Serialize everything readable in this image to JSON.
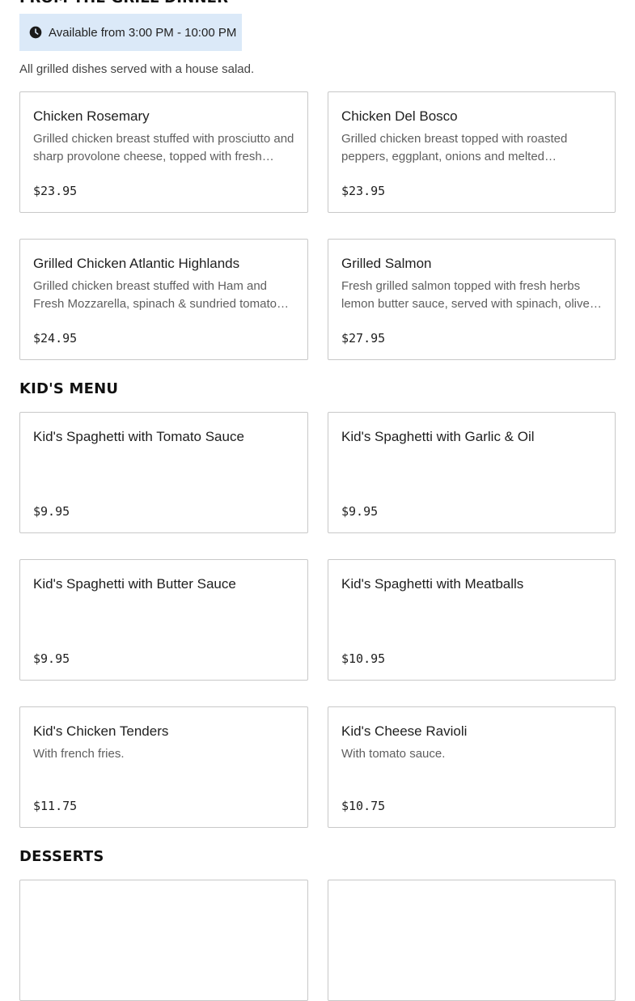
{
  "grill": {
    "title": "FROM THE GRILL DINNER",
    "availability": "Available from 3:00 PM - 10:00 PM",
    "note": "All grilled dishes served with a house salad.",
    "items": [
      {
        "name": "Chicken Rosemary",
        "description": "Grilled chicken breast stuffed with prosciutto and sharp provolone cheese, topped with fresh rosemary",
        "price": "$23.95"
      },
      {
        "name": "Chicken Del Bosco",
        "description": "Grilled chicken breast topped with roasted peppers, eggplant, onions and melted mozzarella cheese",
        "price": "$23.95"
      },
      {
        "name": "Grilled Chicken Atlantic Highlands",
        "description": "Grilled chicken breast stuffed with Ham and Fresh Mozzarella, spinach & sundried tomatoes, & a sauce",
        "price": "$24.95"
      },
      {
        "name": "Grilled Salmon",
        "description": "Fresh grilled salmon topped with fresh herbs lemon butter sauce, served with spinach, olive oil and garlic",
        "price": "$27.95"
      }
    ]
  },
  "kids": {
    "title": "KID'S MENU",
    "items": [
      {
        "name": "Kid's Spaghetti with Tomato Sauce",
        "description": "",
        "price": "$9.95"
      },
      {
        "name": "Kid's Spaghetti with Garlic & Oil",
        "description": "",
        "price": "$9.95"
      },
      {
        "name": "Kid's Spaghetti with Butter Sauce",
        "description": "",
        "price": "$9.95"
      },
      {
        "name": "Kid's Spaghetti with Meatballs",
        "description": "",
        "price": "$10.95"
      },
      {
        "name": "Kid's Chicken Tenders",
        "description": "With french fries.",
        "price": "$11.75"
      },
      {
        "name": "Kid's Cheese Ravioli",
        "description": "With tomato sauce.",
        "price": "$10.75"
      }
    ]
  },
  "desserts": {
    "title": "DESSERTS"
  },
  "colors": {
    "availability_bg": "#dbe9f8",
    "card_border": "#c8c8c8",
    "description_text": "#5f5f5f"
  },
  "icons": {
    "availability": "clock-icon"
  }
}
